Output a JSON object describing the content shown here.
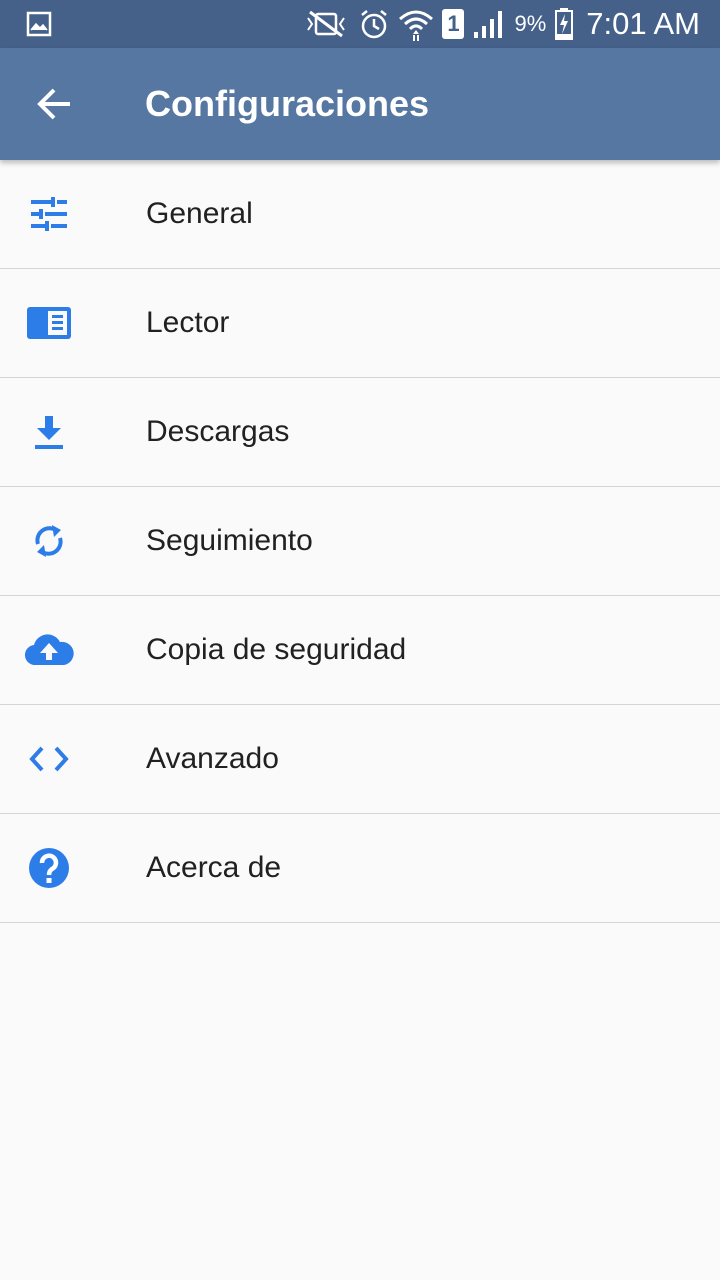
{
  "status_bar": {
    "sim_label": "1",
    "battery_percent": "9%",
    "time": "7:01 AM"
  },
  "app_bar": {
    "title": "Configuraciones"
  },
  "menu": [
    {
      "label": "General",
      "icon": "tune-icon"
    },
    {
      "label": "Lector",
      "icon": "reader-icon"
    },
    {
      "label": "Descargas",
      "icon": "download-icon"
    },
    {
      "label": "Seguimiento",
      "icon": "sync-icon"
    },
    {
      "label": "Copia de seguridad",
      "icon": "cloud-upload-icon"
    },
    {
      "label": "Avanzado",
      "icon": "code-icon"
    },
    {
      "label": "Acerca de",
      "icon": "help-icon"
    }
  ],
  "colors": {
    "status_bar": "#45618a",
    "app_bar": "#5677a1",
    "accent_icon": "#2d7de8",
    "background": "#fafafa"
  }
}
